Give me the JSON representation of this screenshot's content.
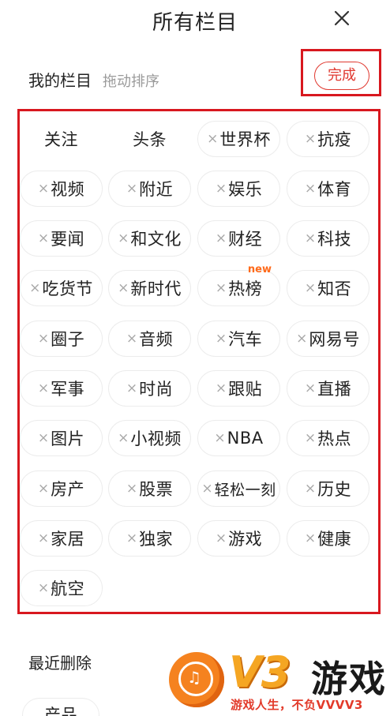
{
  "header": {
    "title": "所有栏目",
    "close_icon": "close-icon"
  },
  "my_channels": {
    "title": "我的栏目",
    "hint": "拖动排序",
    "done_label": "完成"
  },
  "channels": [
    {
      "label": "关注",
      "removable": false
    },
    {
      "label": "头条",
      "removable": false
    },
    {
      "label": "世界杯",
      "removable": true
    },
    {
      "label": "抗疫",
      "removable": true
    },
    {
      "label": "视频",
      "removable": true
    },
    {
      "label": "附近",
      "removable": true
    },
    {
      "label": "娱乐",
      "removable": true
    },
    {
      "label": "体育",
      "removable": true
    },
    {
      "label": "要闻",
      "removable": true
    },
    {
      "label": "和文化",
      "removable": true
    },
    {
      "label": "财经",
      "removable": true
    },
    {
      "label": "科技",
      "removable": true
    },
    {
      "label": "吃货节",
      "removable": true
    },
    {
      "label": "新时代",
      "removable": true
    },
    {
      "label": "热榜",
      "removable": true,
      "badge": "new"
    },
    {
      "label": "知否",
      "removable": true
    },
    {
      "label": "圈子",
      "removable": true
    },
    {
      "label": "音频",
      "removable": true
    },
    {
      "label": "汽车",
      "removable": true
    },
    {
      "label": "网易号",
      "removable": true
    },
    {
      "label": "军事",
      "removable": true
    },
    {
      "label": "时尚",
      "removable": true
    },
    {
      "label": "跟贴",
      "removable": true
    },
    {
      "label": "直播",
      "removable": true
    },
    {
      "label": "图片",
      "removable": true
    },
    {
      "label": "小视频",
      "removable": true
    },
    {
      "label": "NBA",
      "removable": true
    },
    {
      "label": "热点",
      "removable": true
    },
    {
      "label": "房产",
      "removable": true
    },
    {
      "label": "股票",
      "removable": true
    },
    {
      "label": "轻松一刻",
      "removable": true
    },
    {
      "label": "历史",
      "removable": true
    },
    {
      "label": "家居",
      "removable": true
    },
    {
      "label": "独家",
      "removable": true
    },
    {
      "label": "游戏",
      "removable": true
    },
    {
      "label": "健康",
      "removable": true
    },
    {
      "label": "航空",
      "removable": true
    }
  ],
  "remove_glyph": "×",
  "recent": {
    "title": "最近删除",
    "items": [
      "产品"
    ]
  },
  "watermark": {
    "brand": "V3",
    "brand_cn": "游戏",
    "slogan": "游戏人生，不负VVVV3"
  },
  "colors": {
    "accent": "#e0382f",
    "annotation_box": "#d8181f",
    "badge": "#ff6a1a",
    "hint_text": "#9a9a9a"
  }
}
